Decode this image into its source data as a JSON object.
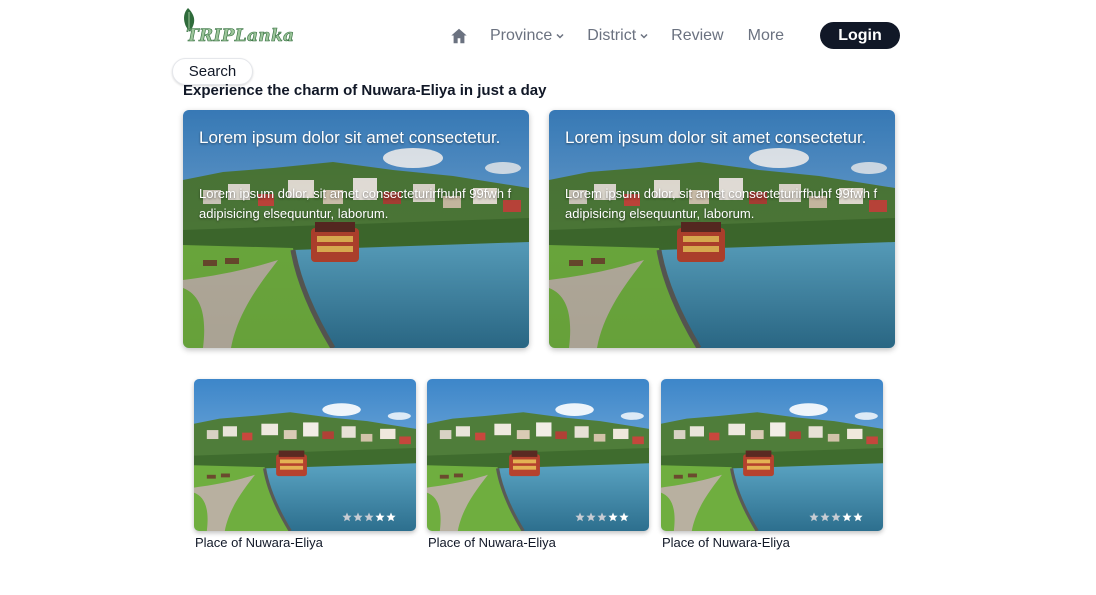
{
  "header": {
    "logo_text": "TRIPLanka",
    "nav": {
      "province": "Province",
      "district": "District",
      "review": "Review",
      "more": "More"
    },
    "login_label": "Login",
    "search_label": "Search"
  },
  "page": {
    "title": "Experience the charm of Nuwara-Eliya in just a day"
  },
  "featured_cards": [
    {
      "title": "Lorem ipsum dolor sit amet consectetur.",
      "text": "Lorem ipsum dolor, sit amet consecteturirfhuhf 99fwh f adipisicing elsequuntur, laborum."
    },
    {
      "title": "Lorem ipsum dolor sit amet consectetur.",
      "text": "Lorem ipsum dolor, sit amet consecteturirfhuhf 99fwh f adipisicing elsequuntur, laborum."
    }
  ],
  "places": [
    {
      "label": "Place of Nuwara-Eliya",
      "rating": 2,
      "max_rating": 5
    },
    {
      "label": "Place of Nuwara-Eliya",
      "rating": 2,
      "max_rating": 5
    },
    {
      "label": "Place of Nuwara-Eliya",
      "rating": 2,
      "max_rating": 5
    }
  ],
  "icons": {
    "home": "home-icon",
    "chevron": "chevron-down-icon",
    "star": "star-icon",
    "logo": "map-pin-leaf-icon"
  },
  "colors": {
    "login_bg": "#111827",
    "nav_text": "#6b7280",
    "logo_green": "#2f6b3b",
    "star_filled": "#ffffff",
    "star_empty": "#c7ccd3"
  }
}
